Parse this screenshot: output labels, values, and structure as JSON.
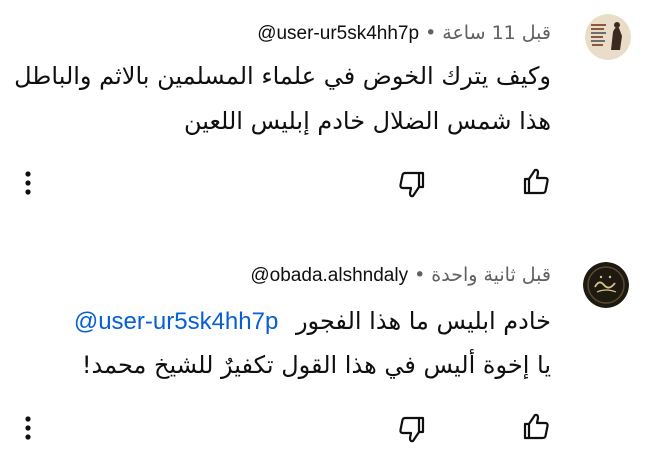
{
  "comments": [
    {
      "author": "@user-ur5sk4hh7p",
      "separator": "•",
      "time": "قبل 11 ساعة",
      "avatar_icon": "profile-photo-avatar",
      "lines": [
        "وكيف يترك الخوض في علماء المسلمين  بالاثم والباطل",
        "هذا شمس الضلال خادم إبليس اللعين"
      ]
    },
    {
      "author": "@obada.alshndaly",
      "separator": "•",
      "time": "قبل ثانية واحدة",
      "avatar_icon": "calligraphy-logo-avatar",
      "line1_text": "خادم ابليس ما هذا الفجور",
      "mention": "@user-ur5sk4hh7p",
      "line2": "يا إخوة أليس في هذا القول تكفيرٌ للشيخ محمد!"
    }
  ],
  "actions": {
    "like_icon": "thumbs-up-icon",
    "dislike_icon": "thumbs-down-icon",
    "more_icon": "more-vert-icon"
  }
}
